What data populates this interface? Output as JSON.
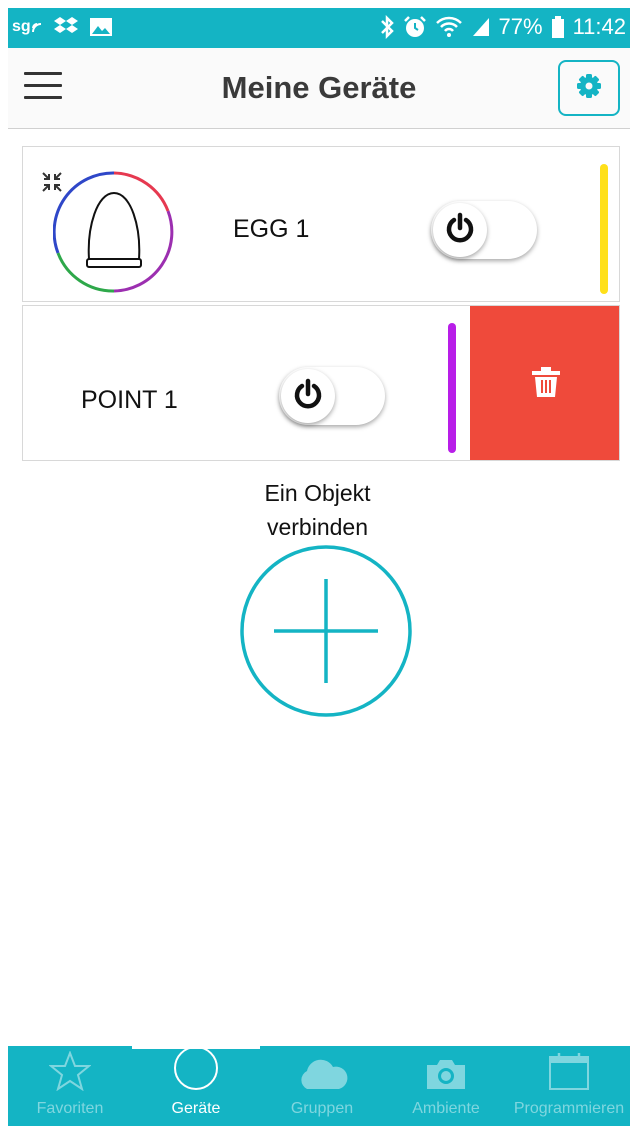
{
  "status_bar": {
    "carrier_badge": "sg",
    "battery_percent": "77%",
    "time": "11:42"
  },
  "header": {
    "title": "Meine Geräte",
    "menu_icon": "hamburger-menu-icon",
    "settings_icon": "gear-icon"
  },
  "devices": [
    {
      "name": "EGG 1",
      "power_icon": "power-icon",
      "power_on": false,
      "color": "#ffe01a",
      "icon": "egg-lamp-icon"
    },
    {
      "name": "POINT 1",
      "power_icon": "power-icon",
      "power_on": false,
      "color": "#b81ee8",
      "delete_icon": "trash-icon",
      "delete_color": "#ef4a3b"
    }
  ],
  "add_object": {
    "label_line1": "Ein Objekt",
    "label_line2": "verbinden",
    "icon": "plus-circle-icon"
  },
  "bottom_nav": {
    "items": [
      {
        "label": "Favoriten",
        "icon": "star-icon",
        "active": false
      },
      {
        "label": "Geräte",
        "icon": "circle-icon",
        "active": true
      },
      {
        "label": "Gruppen",
        "icon": "cloud-icon",
        "active": false
      },
      {
        "label": "Ambiente",
        "icon": "camera-icon",
        "active": false
      },
      {
        "label": "Programmieren",
        "icon": "calendar-icon",
        "active": false
      }
    ]
  },
  "colors": {
    "accent": "#14b4c4",
    "delete": "#ef4a3b"
  }
}
